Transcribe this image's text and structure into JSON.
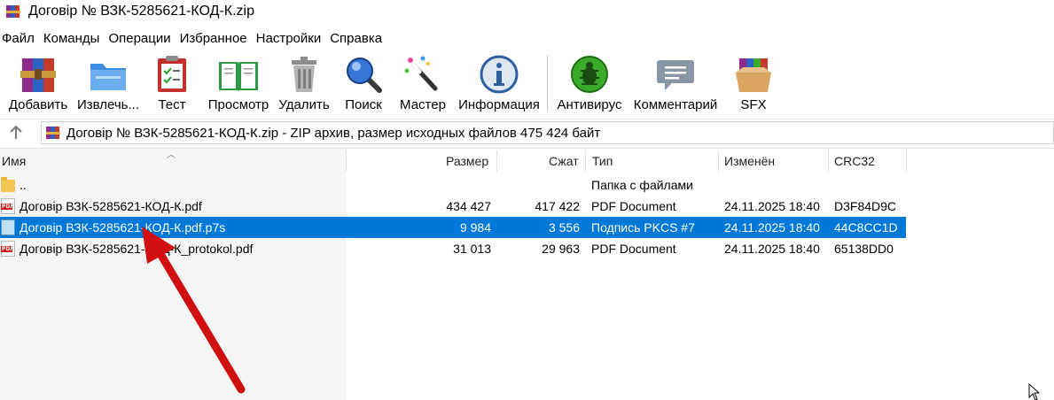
{
  "window": {
    "title": "Договір № ВЗК-5285621-КОД-К.zip",
    "app_icon": "winrar-icon"
  },
  "menu": [
    "Файл",
    "Команды",
    "Операции",
    "Избранное",
    "Настройки",
    "Справка"
  ],
  "toolbar": {
    "buttons": [
      {
        "label": "Добавить",
        "icon": "add-archive-icon"
      },
      {
        "label": "Извлечь...",
        "icon": "extract-icon"
      },
      {
        "label": "Тест",
        "icon": "test-icon"
      },
      {
        "label": "Просмотр",
        "icon": "view-icon"
      },
      {
        "label": "Удалить",
        "icon": "delete-icon"
      },
      {
        "label": "Поиск",
        "icon": "search-icon"
      },
      {
        "label": "Мастер",
        "icon": "wizard-icon"
      },
      {
        "label": "Информация",
        "icon": "info-icon"
      },
      {
        "label": "Антивирус",
        "icon": "antivirus-icon"
      },
      {
        "label": "Комментарий",
        "icon": "comment-icon"
      },
      {
        "label": "SFX",
        "icon": "sfx-icon"
      }
    ]
  },
  "address": {
    "text": "Договір № ВЗК-5285621-КОД-К.zip - ZIP архив, размер исходных файлов 475 424 байт"
  },
  "columns": {
    "name": "Имя",
    "size": "Размер",
    "packed": "Сжат",
    "type": "Тип",
    "modified": "Изменён",
    "crc": "CRC32"
  },
  "files": [
    {
      "name": "..",
      "size": "",
      "packed": "",
      "type": "Папка с файлами",
      "modified": "",
      "crc": "",
      "icon": "folder-icon"
    },
    {
      "name": "Договір ВЗК-5285621-КОД-К.pdf",
      "size": "434 427",
      "packed": "417 422",
      "type": "PDF Document",
      "modified": "24.11.2025 18:40",
      "crc": "D3F84D9C",
      "icon": "pdf-icon"
    },
    {
      "name": "Договір ВЗК-5285621-КОД-К.pdf.p7s",
      "size": "9 984",
      "packed": "3 556",
      "type": "Подпись PKCS #7",
      "modified": "24.11.2025 18:40",
      "crc": "44C8CC1D",
      "icon": "p7s-file-icon",
      "selected": true
    },
    {
      "name": "Договір ВЗК-5285621-КОД-К_protokol.pdf",
      "size": "31 013",
      "packed": "29 963",
      "type": "PDF Document",
      "modified": "24.11.2025 18:40",
      "crc": "65138DD0",
      "icon": "pdf-icon"
    }
  ],
  "colors": {
    "selection": "#0078d7",
    "arrow": "#d01010"
  }
}
